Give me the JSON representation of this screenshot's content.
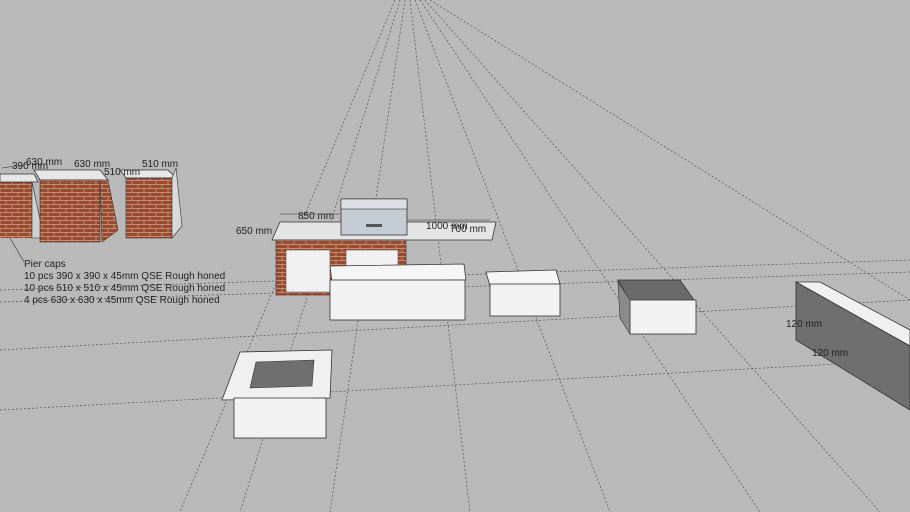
{
  "dimensions": {
    "pier_small_a": "390 mm",
    "pier_large_top": "630 mm",
    "pier_large_top_b": "630 mm",
    "pier_med_top": "510 mm",
    "pier_med_side": "510 mm",
    "bbq_width": "850 mm",
    "bbq_depth": "650 mm",
    "bench_length": "1000 mm",
    "bench_depth": "700 mm",
    "seat_a": "120 mm",
    "seat_b": "120 mm"
  },
  "notes": {
    "title": "Pier caps",
    "line1": "10 pcs 390 x 390 x 45mm QSE Rough honed",
    "line2": "10 pcs 510 x 510 x 45mm QSE Rough honed",
    "line3": "4 pcs    630 x 630 x 45mm QSE Rough honed"
  },
  "colors": {
    "background": "#b9b9b9",
    "brick": "#9b4a32",
    "cap": "#e6e6e6",
    "steel": "#c4ccd4",
    "planter": "#f2f2f2"
  }
}
